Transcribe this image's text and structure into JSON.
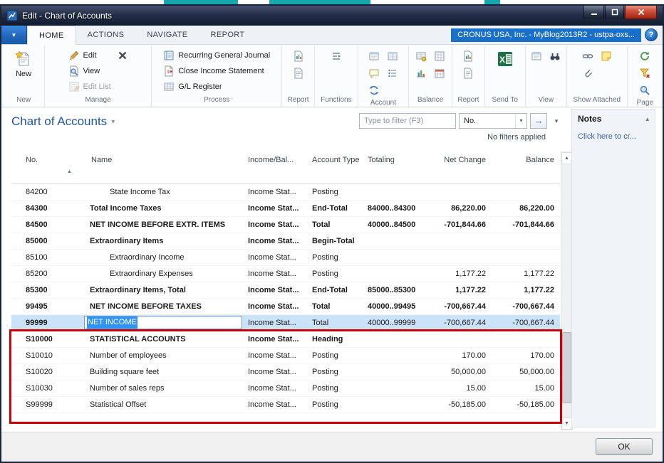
{
  "window": {
    "title": "Edit - Chart of Accounts"
  },
  "tab_bar": {
    "tabs": [
      "HOME",
      "ACTIONS",
      "NAVIGATE",
      "REPORT"
    ],
    "active_tab": "HOME",
    "company_badge": "CRONUS USA, Inc. - MyBlog2013R2 - ustpa-oxs..."
  },
  "ribbon": {
    "groups": [
      {
        "label": "New"
      },
      {
        "label": "Manage"
      },
      {
        "label": "Process"
      },
      {
        "label": "Report"
      },
      {
        "label": "Functions"
      },
      {
        "label": "Account"
      },
      {
        "label": "Balance"
      },
      {
        "label": "Report"
      },
      {
        "label": "Send To"
      },
      {
        "label": "View"
      },
      {
        "label": "Show Attached"
      },
      {
        "label": "Page"
      }
    ],
    "buttons": {
      "new": "New",
      "edit": "Edit",
      "view": "View",
      "edit_list": "Edit List",
      "recurring_general_journal": "Recurring General Journal",
      "close_income_statement": "Close Income Statement",
      "gl_register": "G/L Register"
    }
  },
  "page": {
    "title": "Chart of Accounts",
    "filter_placeholder": "Type to filter (F3)",
    "filter_column": "No.",
    "filter_status": "No filters applied"
  },
  "table": {
    "columns": [
      "No.",
      "Name",
      "Income/Bal...",
      "Account Type",
      "Totaling",
      "Net Change",
      "Balance"
    ],
    "rows": [
      {
        "no": "84200",
        "name": "State Income Tax",
        "indent": 1,
        "bold": false,
        "income": "Income Stat...",
        "type": "Posting",
        "totaling": "",
        "net_change": "",
        "balance": ""
      },
      {
        "no": "84300",
        "name": "Total Income Taxes",
        "indent": 0,
        "bold": true,
        "income": "Income Stat...",
        "type": "End-Total",
        "totaling": "84000..84300",
        "net_change": "86,220.00",
        "balance": "86,220.00"
      },
      {
        "no": "84500",
        "name": "NET INCOME BEFORE EXTR. ITEMS",
        "indent": 0,
        "bold": true,
        "income": "Income Stat...",
        "type": "Total",
        "totaling": "40000..84500",
        "net_change": "-701,844.66",
        "balance": "-701,844.66"
      },
      {
        "no": "85000",
        "name": "Extraordinary Items",
        "indent": 0,
        "bold": true,
        "income": "Income Stat...",
        "type": "Begin-Total",
        "totaling": "",
        "net_change": "",
        "balance": ""
      },
      {
        "no": "85100",
        "name": "Extraordinary Income",
        "indent": 1,
        "bold": false,
        "income": "Income Stat...",
        "type": "Posting",
        "totaling": "",
        "net_change": "",
        "balance": ""
      },
      {
        "no": "85200",
        "name": "Extraordinary Expenses",
        "indent": 1,
        "bold": false,
        "income": "Income Stat...",
        "type": "Posting",
        "totaling": "",
        "net_change": "1,177.22",
        "balance": "1,177.22"
      },
      {
        "no": "85300",
        "name": "Extraordinary Items, Total",
        "indent": 0,
        "bold": true,
        "income": "Income Stat...",
        "type": "End-Total",
        "totaling": "85000..85300",
        "net_change": "1,177.22",
        "balance": "1,177.22"
      },
      {
        "no": "99495",
        "name": "NET INCOME BEFORE TAXES",
        "indent": 0,
        "bold": true,
        "income": "Income Stat...",
        "type": "Total",
        "totaling": "40000..99495",
        "net_change": "-700,667.44",
        "balance": "-700,667.44"
      },
      {
        "no": "99999",
        "name": "NET INCOME",
        "indent": 0,
        "bold": false,
        "selected": true,
        "editing": true,
        "income": "Income Stat...",
        "type": "Total",
        "totaling": "40000..99999",
        "net_change": "-700,667.44",
        "balance": "-700,667.44"
      },
      {
        "no": "S10000",
        "name": "STATISTICAL ACCOUNTS",
        "indent": 0,
        "bold": true,
        "income": "Income Stat...",
        "type": "Heading",
        "totaling": "",
        "net_change": "",
        "balance": ""
      },
      {
        "no": "S10010",
        "name": "Number of employees",
        "indent": 0,
        "bold": false,
        "income": "Income Stat...",
        "type": "Posting",
        "totaling": "",
        "net_change": "170.00",
        "balance": "170.00"
      },
      {
        "no": "S10020",
        "name": "Building square feet",
        "indent": 0,
        "bold": false,
        "income": "Income Stat...",
        "type": "Posting",
        "totaling": "",
        "net_change": "50,000.00",
        "balance": "50,000.00"
      },
      {
        "no": "S10030",
        "name": "Number of sales reps",
        "indent": 0,
        "bold": false,
        "income": "Income Stat...",
        "type": "Posting",
        "totaling": "",
        "net_change": "15.00",
        "balance": "15.00"
      },
      {
        "no": "S99999",
        "name": "Statistical Offset",
        "indent": 0,
        "bold": false,
        "income": "Income Stat...",
        "type": "Posting",
        "totaling": "",
        "net_change": "-50,185.00",
        "balance": "-50,185.00"
      }
    ]
  },
  "notes": {
    "title": "Notes",
    "link": "Click here to cr..."
  },
  "footer": {
    "ok": "OK"
  },
  "icons": {
    "dropdown_caret": "▾",
    "title_caret": "▾",
    "sort_ascending": "▲",
    "collapse_caret": "▴",
    "go_arrow": "→",
    "help": "?",
    "scroll_up": "▲",
    "scroll_down": "▼",
    "app_menu_caret": "▼"
  },
  "colors": {
    "accent_blue": "#1a70c8",
    "title_blue": "#2257a4",
    "selection_blue": "#3194f0",
    "annotation_red": "#cc0000"
  }
}
